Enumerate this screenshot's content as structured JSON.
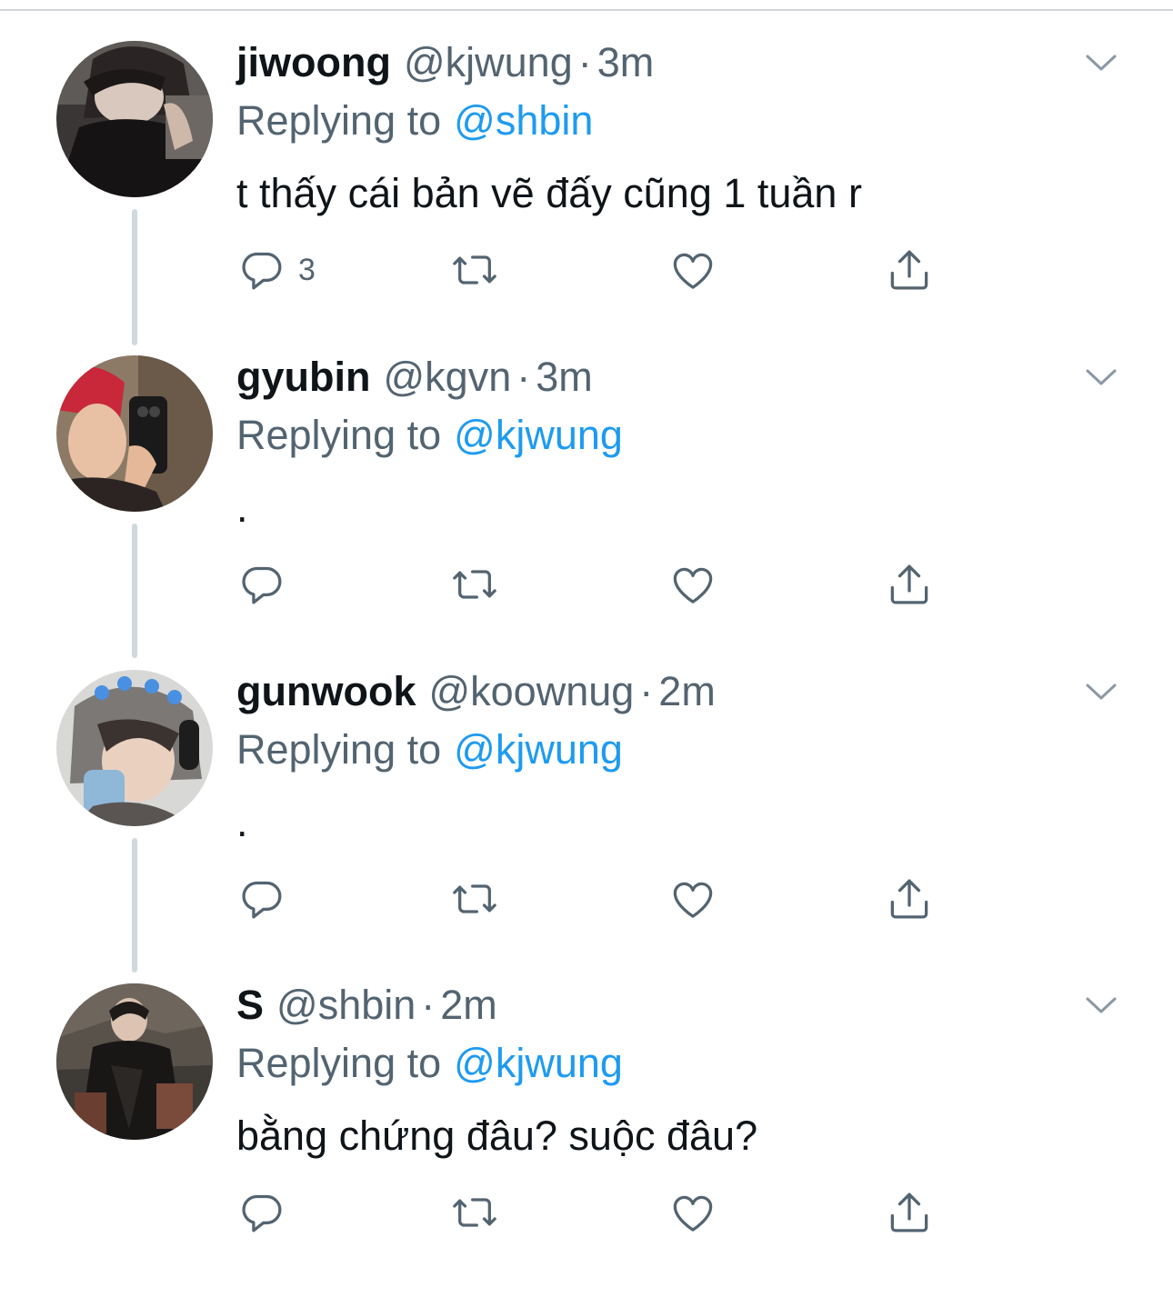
{
  "tweets": [
    {
      "name": "jiwoong",
      "handle": "@kjwung",
      "time": "3m",
      "reply_label": "Replying to",
      "reply_to": "@shbin",
      "text": "t thấy cái bản vẽ đấy cũng 1 tuần r",
      "reply_count": "3"
    },
    {
      "name": "gyubin",
      "handle": "@kgvn",
      "time": "3m",
      "reply_label": "Replying to",
      "reply_to": "@kjwung",
      "text": ".",
      "reply_count": ""
    },
    {
      "name": "gunwook",
      "handle": "@koownug",
      "time": "2m",
      "reply_label": "Replying to",
      "reply_to": "@kjwung",
      "text": ".",
      "reply_count": ""
    },
    {
      "name": "S",
      "handle": "@shbin",
      "time": "2m",
      "reply_label": "Replying to",
      "reply_to": "@kjwung",
      "text": "bằng chứng đâu? suộc đâu?",
      "reply_count": ""
    }
  ],
  "separator": "·",
  "icons": {
    "reply": "reply-icon",
    "retweet": "retweet-icon",
    "like": "heart-icon",
    "share": "share-icon",
    "more": "chevron-down-icon"
  },
  "colors": {
    "text": "#0f1419",
    "muted": "#536471",
    "link": "#1d9bf0",
    "line": "#cfd9de"
  }
}
